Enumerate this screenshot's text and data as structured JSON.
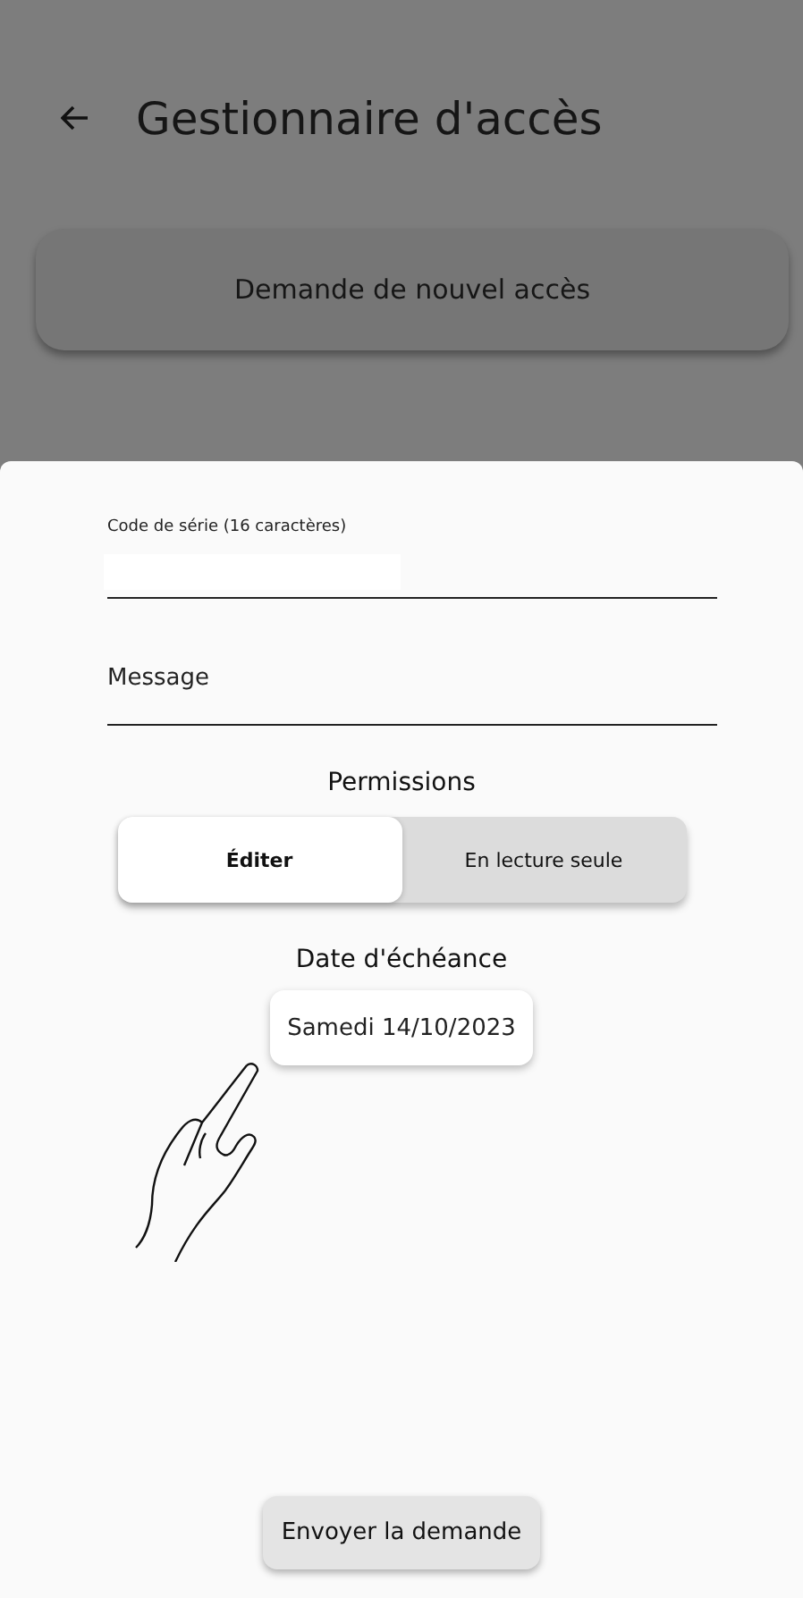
{
  "app_bar": {
    "title": "Gestionnaire d'accès"
  },
  "new_access_button": {
    "label": "Demande de nouvel accès"
  },
  "sheet": {
    "serial_field": {
      "label": "Code de série (16 caractères)"
    },
    "message_field": {
      "placeholder": "Message"
    },
    "permissions": {
      "title": "Permissions",
      "options": [
        {
          "label": "Éditer",
          "selected": true
        },
        {
          "label": "En lecture seule",
          "selected": false
        }
      ]
    },
    "due_date": {
      "title": "Date d'échéance",
      "value": "Samedi 14/10/2023"
    },
    "send_button": {
      "label": "Envoyer la demande"
    }
  }
}
